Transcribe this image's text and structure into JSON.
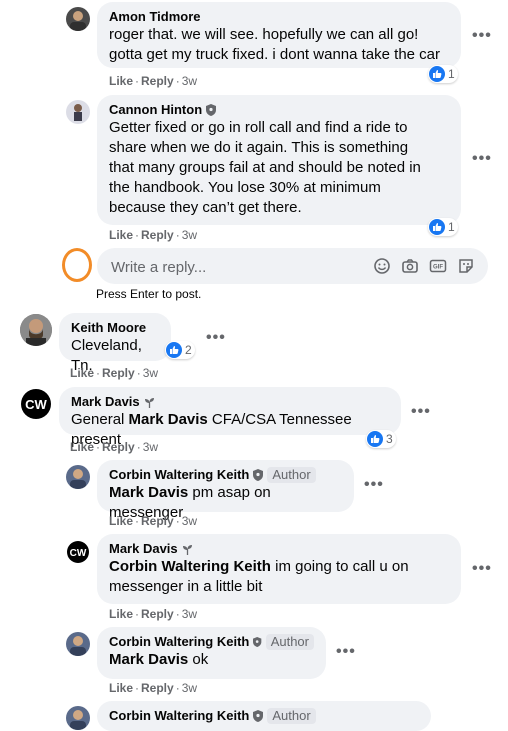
{
  "comments": [
    {
      "name": "Amon Tidmore",
      "text": "roger that. we will see. hopefully we can all go! gotta get my truck fixed. i dont wanna take the car",
      "reactions": "1"
    },
    {
      "name": "Cannon Hinton",
      "text": "Getter fixed or go in roll call and find a ride to share when we do it again. This is something that many groups fail at and should be noted in the handbook. You lose 30% at minimum because they can’t get there.",
      "reactions": "1"
    },
    {
      "name": "Keith Moore",
      "text": "Cleveland, Tn.",
      "reactions": "2"
    },
    {
      "name": "Mark Davis",
      "text_prefix": "General ",
      "text_mention": "Mark Davis",
      "text_suffix": " CFA/CSA Tennessee present",
      "reactions": "3"
    },
    {
      "name": "Corbin Waltering Keith",
      "badge": "Author",
      "mention": "Mark Davis",
      "text": " pm asap on messenger"
    },
    {
      "name": "Mark Davis",
      "mention": "Corbin Waltering Keith",
      "text": " im going to call u on messenger in a little bit"
    },
    {
      "name": "Corbin Waltering Keith",
      "badge": "Author",
      "mention": "Mark Davis",
      "text": " ok"
    },
    {
      "name": "Corbin Waltering Keith",
      "badge": "Author"
    }
  ],
  "actions": {
    "like": "Like",
    "reply": "Reply",
    "time": "3w",
    "sep": "·"
  },
  "reply_box": {
    "placeholder": "Write a reply...",
    "hint": "Press Enter to post."
  },
  "more": "•••",
  "colors": {
    "accent": "#1877f2",
    "bubble": "#f0f2f5",
    "meta": "#65676b",
    "focus_ring": "#f28c28"
  }
}
